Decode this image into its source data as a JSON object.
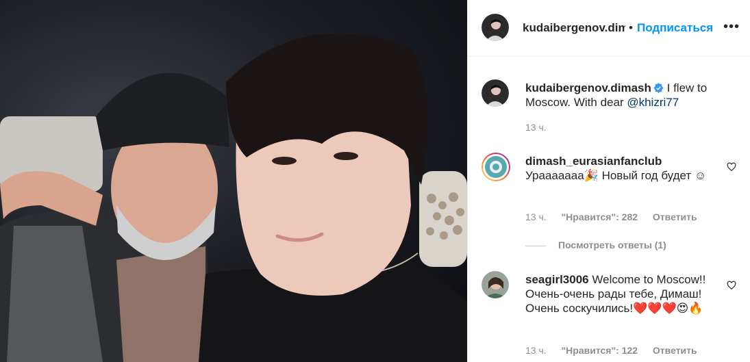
{
  "header": {
    "username": "kudaibergenov.dimash",
    "separator": "•",
    "follow_label": "Подписаться",
    "more_icon": "more-horizontal-icon"
  },
  "caption": {
    "username": "kudaibergenov.dimash",
    "text": "I flew to Moscow. With dear ",
    "mention": "@khizri77",
    "time": "13 ч.",
    "verified_icon": "verified-badge-icon"
  },
  "comments": [
    {
      "username": "dimash_eurasianfanclub",
      "text": "Урааааааа🎉 Новый год будет ☺",
      "time": "13 ч.",
      "likes": "\"Нравится\": 282",
      "reply_label": "Ответить",
      "view_replies": "Посмотреть ответы (1)"
    },
    {
      "username": "seagirl3006",
      "text": "Welcome to Moscow!! Очень-очень рады тебе, Димаш! Очень соскучились!❤️❤️❤️😍🔥",
      "time": "13 ч.",
      "likes": "\"Нравится\": 122",
      "reply_label": "Ответить"
    }
  ],
  "colors": {
    "link_blue": "#0095f6",
    "mention_blue": "#00376b",
    "muted": "#8e8e8e",
    "text": "#262626",
    "verified": "#3897f0"
  }
}
